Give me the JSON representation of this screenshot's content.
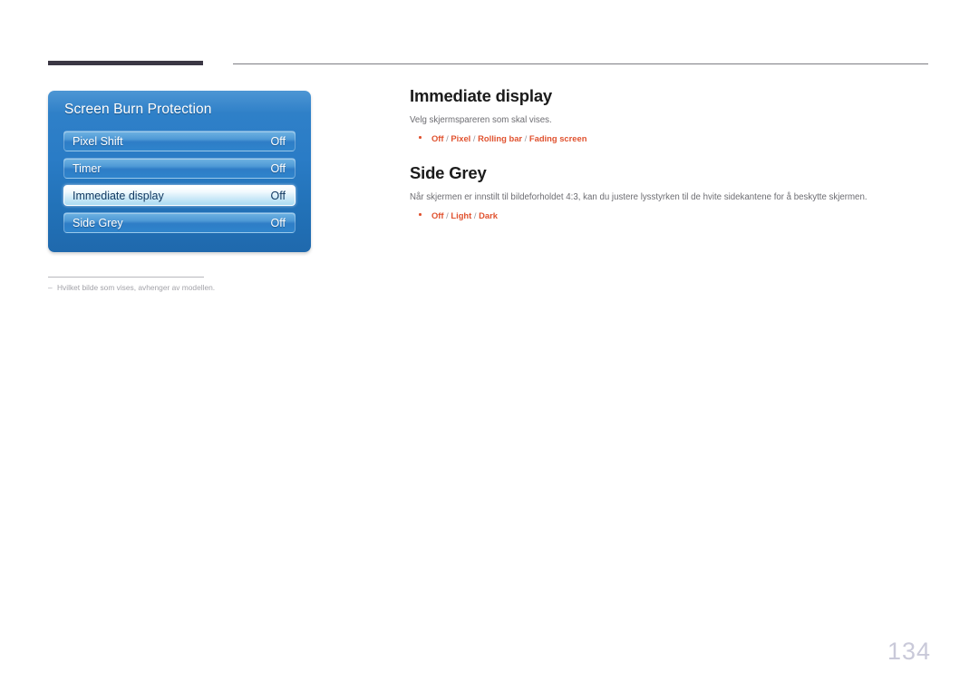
{
  "rules": {
    "dark_bar": "#3b3744",
    "thin_line": "#7d7d83"
  },
  "osd": {
    "title": "Screen Burn Protection",
    "rows": [
      {
        "label": "Pixel Shift",
        "value": "Off",
        "selected": false
      },
      {
        "label": "Timer",
        "value": "Off",
        "selected": false
      },
      {
        "label": "Immediate display",
        "value": "Off",
        "selected": true
      },
      {
        "label": "Side Grey",
        "value": "Off",
        "selected": false
      }
    ]
  },
  "footnote": {
    "dash": "–",
    "text": "Hvilket bilde som vises, avhenger av modellen."
  },
  "sections": [
    {
      "title": "Immediate display",
      "desc": "Velg skjermspareren som skal vises.",
      "option_parts": {
        "o1": "Off",
        "s1": " / ",
        "o2": "Pixel",
        "s2": " / ",
        "o3": "Rolling bar",
        "s3": " / ",
        "o4": "Fading screen"
      }
    },
    {
      "title": "Side Grey",
      "desc": "Når skjermen er innstilt til bildeforholdet 4:3, kan du justere lysstyrken til de hvite sidekantene for å beskytte skjermen.",
      "option_parts": {
        "o1": "Off",
        "s1": " / ",
        "o2": "Light",
        "s2": " / ",
        "o3": "Dark"
      }
    }
  ],
  "page_number": "134",
  "colors": {
    "accent_orange": "#e0522f",
    "heading": "#1b1b1b",
    "body_text": "#6d6d72",
    "page_number": "#c9c9d9",
    "osd_blue_top": "#4d96d4",
    "osd_blue_bottom": "#1f69ad"
  }
}
